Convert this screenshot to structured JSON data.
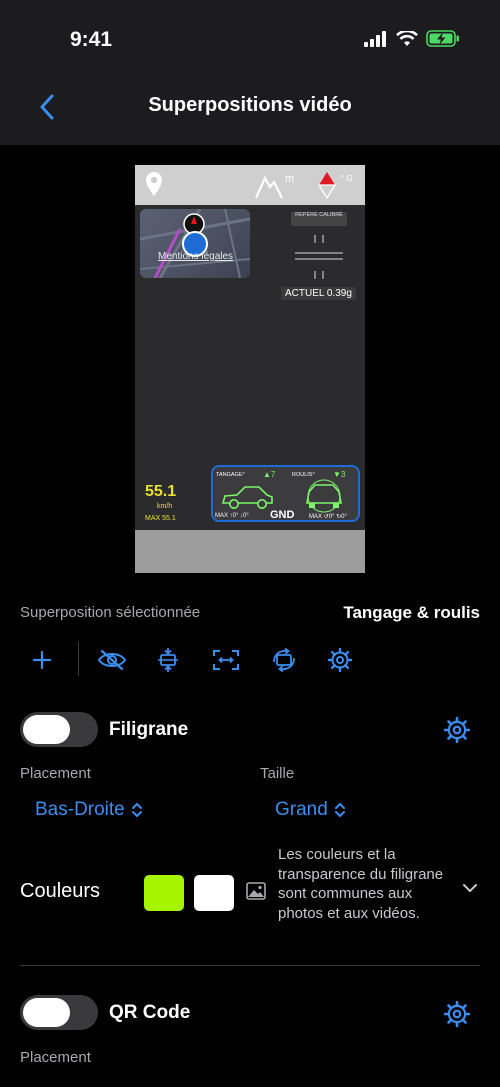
{
  "status_bar": {
    "time": "9:41"
  },
  "nav": {
    "title": "Superpositions vidéo",
    "back_icon": "chevron-left-icon"
  },
  "preview": {
    "map_note": "Mentions légales",
    "calibration": "REPÈRE CALIBRÉ",
    "actual_g": "ACTUEL 0.39g",
    "altitude_unit": "m",
    "g_unit": "°.G",
    "speed": "55.1",
    "speed_unit": "km/h",
    "speed_max": "MAX 55.1",
    "pitch_label": "TANGAGE°",
    "pitch_value": "▲7",
    "roll_label": "ROULIS°",
    "roll_value": "▼3",
    "pitch_max": "MAX ↑0° ↓0°",
    "ground": "GND",
    "roll_max": "MAX ↺0° ↻0°"
  },
  "selection": {
    "label": "Superposition sélectionnée",
    "value": "Tangage & roulis"
  },
  "toolbar": {
    "icons": [
      "plus-icon",
      "eye-slash-icon",
      "align-vertical-center-icon",
      "resize-icon",
      "rotate-icon",
      "gear-icon"
    ]
  },
  "watermark": {
    "label": "Filigrane",
    "enabled": false,
    "placement_label": "Placement",
    "placement_value": "Bas-Droite",
    "size_label": "Taille",
    "size_value": "Grand",
    "colors_label": "Couleurs",
    "color1": "#a6f500",
    "color2": "#ffffff",
    "note": "Les couleurs et la transparence du filigrane sont communes aux photos et aux vidéos."
  },
  "qrcode": {
    "label": "QR Code",
    "enabled": false,
    "placement_label": "Placement"
  },
  "colors": {
    "accent": "#3b8ef0",
    "background": "#000000",
    "bar": "#1c1c1e"
  }
}
